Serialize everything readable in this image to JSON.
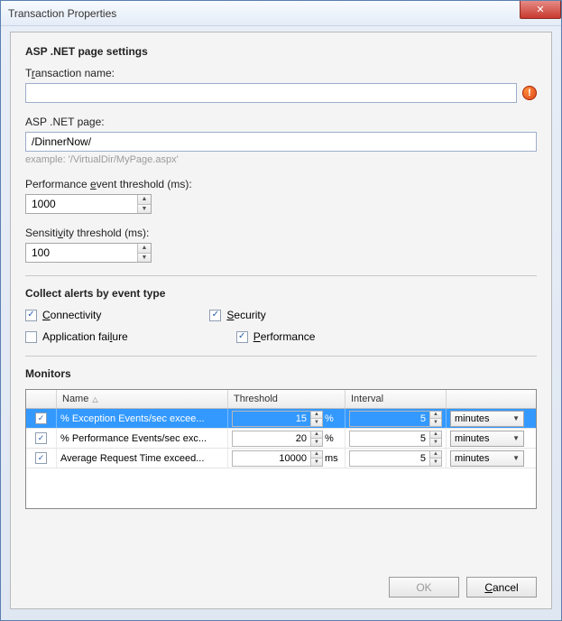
{
  "window": {
    "title": "Transaction Properties"
  },
  "section": {
    "asp_title": "ASP .NET page settings",
    "tx_label_pre": "T",
    "tx_label_mid": "r",
    "tx_label_post": "ansaction name:",
    "asp_page_label": "ASP .NET page:",
    "asp_page_value": "/DinnerNow/",
    "asp_hint": "example: '/VirtualDir/MyPage.aspx'",
    "perf_pre": "Performance ",
    "perf_u": "e",
    "perf_post": "vent threshold (ms):",
    "perf_value": "1000",
    "sens_pre": "Sensiti",
    "sens_u": "v",
    "sens_post": "ity threshold (ms):",
    "sens_value": "100"
  },
  "collect": {
    "title": "Collect alerts by event type",
    "rows": [
      {
        "a": {
          "label": "Connectivity",
          "u": "C",
          "rest": "onnectivity",
          "checked": true
        },
        "b": {
          "label": "Security",
          "u": "S",
          "rest": "ecurity",
          "checked": true
        }
      },
      {
        "a": {
          "label": "Application failure",
          "pre": "Application fai",
          "u": "l",
          "rest": "ure",
          "checked": false
        },
        "b": {
          "label": "Performance",
          "u": "P",
          "rest": "erformance",
          "checked": true
        }
      }
    ]
  },
  "monitors": {
    "title": "Monitors",
    "headers": {
      "name": "Name",
      "threshold": "Threshold",
      "interval": "Interval"
    },
    "rows": [
      {
        "checked": true,
        "name": "% Exception Events/sec excee...",
        "threshold": "15",
        "unit": "%",
        "interval": "5",
        "interval_unit": "minutes",
        "selected": true
      },
      {
        "checked": true,
        "name": "% Performance Events/sec exc...",
        "threshold": "20",
        "unit": "%",
        "interval": "5",
        "interval_unit": "minutes",
        "selected": false
      },
      {
        "checked": true,
        "name": "Average Request Time exceed...",
        "threshold": "10000",
        "unit": "ms",
        "interval": "5",
        "interval_unit": "minutes",
        "selected": false
      }
    ]
  },
  "buttons": {
    "ok": "OK",
    "cancel_u": "C",
    "cancel_rest": "ancel"
  }
}
